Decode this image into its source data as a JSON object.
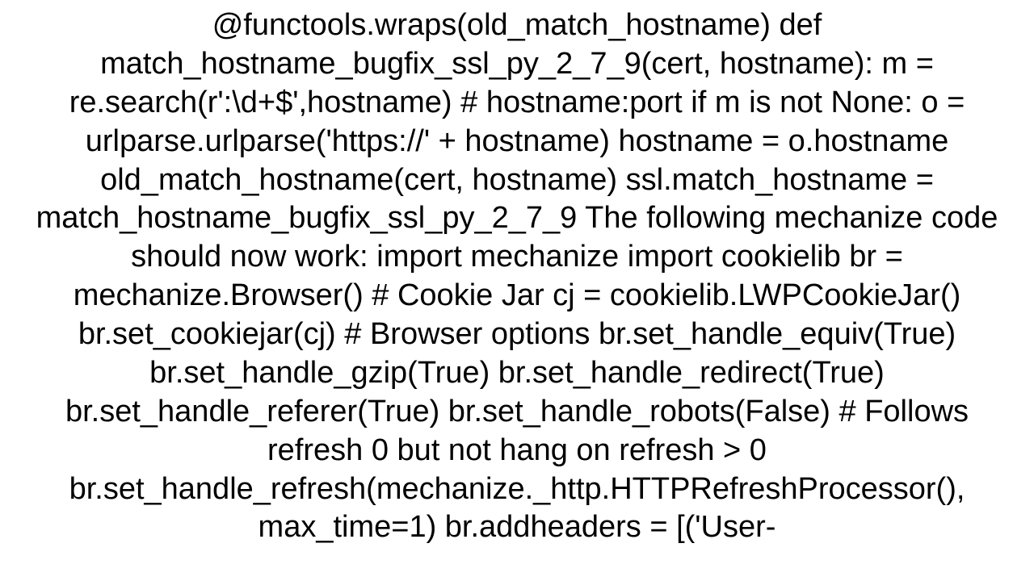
{
  "document": {
    "text": "@functools.wraps(old_match_hostname) def match_hostname_bugfix_ssl_py_2_7_9(cert, hostname):     m = re.search(r':\\d+$',hostname)  # hostname:port     if m is not None:         o = urlparse.urlparse('https://' + hostname)         hostname = o.hostname     old_match_hostname(cert, hostname)  ssl.match_hostname = match_hostname_bugfix_ssl_py_2_7_9  The following mechanize code should now work: import mechanize import cookielib  br = mechanize.Browser()  # Cookie Jar cj = cookielib.LWPCookieJar() br.set_cookiejar(cj)  # Browser options br.set_handle_equiv(True) br.set_handle_gzip(True) br.set_handle_redirect(True) br.set_handle_referer(True) br.set_handle_robots(False)  # Follows refresh 0 but not hang on refresh > 0 br.set_handle_refresh(mechanize._http.HTTPRefreshProcessor(), max_time=1)  br.addheaders = [('User-"
  }
}
